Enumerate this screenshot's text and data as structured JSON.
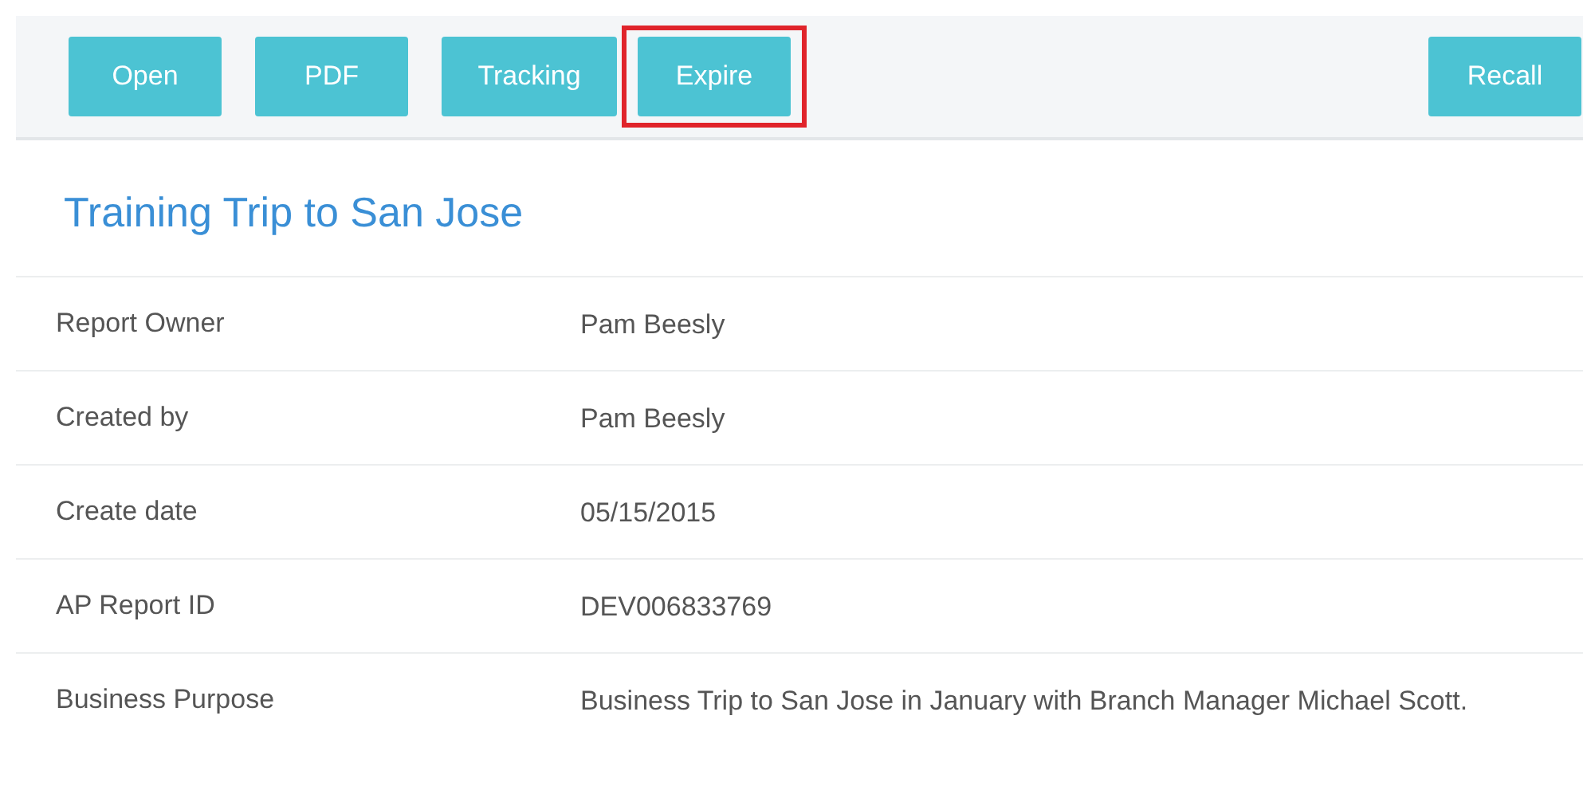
{
  "toolbar": {
    "left_buttons": [
      {
        "label": "Open",
        "highlighted": false
      },
      {
        "label": "PDF",
        "highlighted": false
      },
      {
        "label": "Tracking",
        "highlighted": false
      },
      {
        "label": "Expire",
        "highlighted": true
      }
    ],
    "right_buttons": [
      {
        "label": "Recall",
        "highlighted": false
      }
    ]
  },
  "report": {
    "title": "Training Trip to San Jose",
    "fields": [
      {
        "label": "Report Owner",
        "value": "Pam Beesly"
      },
      {
        "label": "Created by",
        "value": "Pam Beesly"
      },
      {
        "label": "Create date",
        "value": "05/15/2015"
      },
      {
        "label": "AP Report ID",
        "value": "DEV006833769"
      },
      {
        "label": "Business Purpose",
        "value": "Business Trip to San Jose in January with Branch Manager Michael Scott."
      }
    ]
  }
}
